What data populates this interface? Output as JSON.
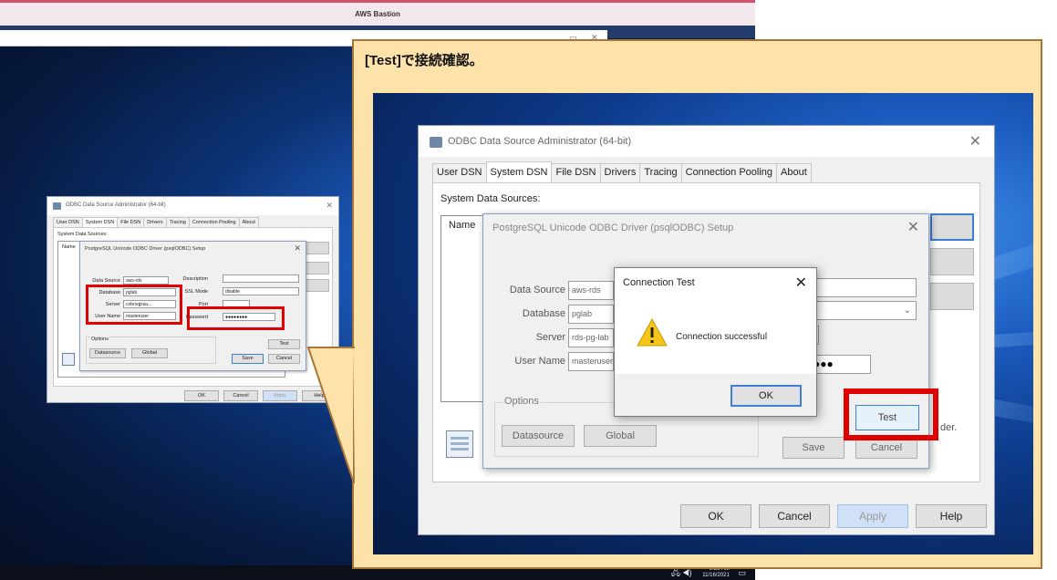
{
  "remote_window": {
    "title": "AWS Bastion",
    "tray_time": "8:28 AM",
    "tray_date": "11/16/2021"
  },
  "callout": {
    "title": "[Test]で接続確認。"
  },
  "odbc_admin": {
    "title": "ODBC Data Source Administrator (64-bit)",
    "tabs": [
      "User DSN",
      "System DSN",
      "File DSN",
      "Drivers",
      "Tracing",
      "Connection Pooling",
      "About"
    ],
    "active_tab": "System DSN",
    "list_label": "System Data Sources:",
    "list_header": "Name",
    "buttons": {
      "ok": "OK",
      "cancel": "Cancel",
      "apply": "Apply",
      "help": "Help"
    },
    "under_text": "der."
  },
  "setup_dialog": {
    "title": "PostgreSQL Unicode ODBC Driver (psqlODBC) Setup",
    "fields": {
      "data_source_label": "Data Source",
      "data_source_value": "aws-rds",
      "database_label": "Database",
      "database_value": "pglab",
      "server_label": "Server",
      "server_value": "rds-pg-lab",
      "server_value_small": "cobrxqjxuu...",
      "username_label": "User Name",
      "username_value": "masteruser",
      "description_label": "Description",
      "ssl_mode_label": "SSL Mode",
      "ssl_mode_value": "disable",
      "port_label": "Port",
      "password_label": "Password",
      "password_value": "●●●●●●●●",
      "password_value_zoom": "●●●"
    },
    "options_label": "Options",
    "buttons": {
      "datasource": "Datasource",
      "global": "Global",
      "test": "Test",
      "save": "Save",
      "cancel": "Cancel"
    }
  },
  "connection_test": {
    "title": "Connection Test",
    "message": "Connection successful",
    "ok": "OK"
  },
  "colors": {
    "highlight": "#e00000",
    "callout_bg": "#fde3aa",
    "callout_border": "#a67437"
  }
}
